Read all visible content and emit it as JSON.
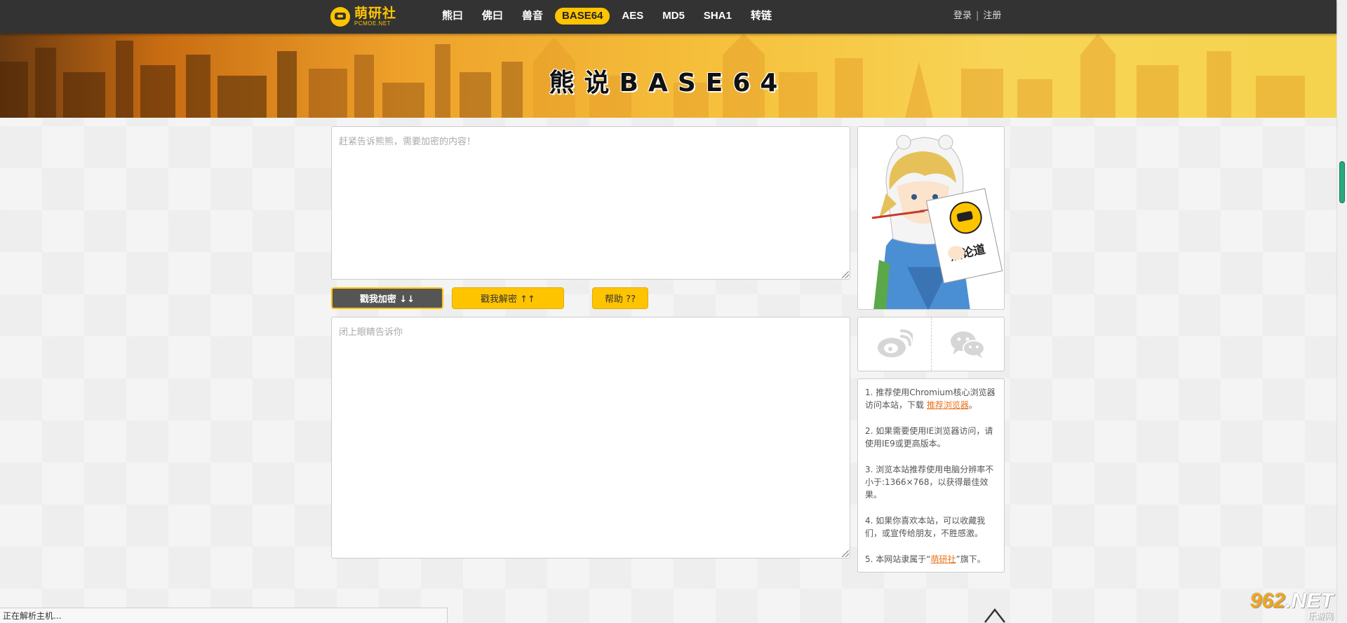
{
  "header": {
    "logo_cn": "萌研社",
    "logo_en": "PCMOE.NET",
    "nav": [
      {
        "label": "熊曰"
      },
      {
        "label": "佛曰"
      },
      {
        "label": "兽音"
      },
      {
        "label": "BASE64",
        "active": true
      },
      {
        "label": "AES"
      },
      {
        "label": "MD5"
      },
      {
        "label": "SHA1"
      },
      {
        "label": "转链"
      }
    ],
    "login": "登录",
    "separator": "|",
    "register": "注册"
  },
  "banner": {
    "title": "熊说BASE64"
  },
  "main": {
    "input_placeholder": "赶紧告诉熊熊，需要加密的内容！",
    "output_placeholder": "闭上眼睛告诉你",
    "encrypt_label": "戳我加密 ↓↓",
    "decrypt_label": "戳我解密 ↑↑",
    "help_label": "帮助 ??"
  },
  "sidebar": {
    "mascot_sign": "熊论道",
    "social": [
      {
        "icon": "weibo-icon"
      },
      {
        "icon": "wechat-icon"
      }
    ],
    "notes": [
      {
        "text": "1. 推荐使用Chromium核心浏览器访问本站，下载 ",
        "link": "推荐浏览器",
        "suffix": "。"
      },
      {
        "text": "2. 如果需要使用IE浏览器访问，请使用IE9或更高版本。",
        "link": "",
        "suffix": ""
      },
      {
        "text": "3. 浏览本站推荐使用电脑分辨率不小于:1366×768，以获得最佳效果。",
        "link": "",
        "suffix": ""
      },
      {
        "text": "4. 如果你喜欢本站，可以收藏我们，或宣传给朋友，不胜感激。",
        "link": "",
        "suffix": ""
      },
      {
        "text": "5. 本网站隶属于“",
        "link": "萌研社",
        "suffix": "”旗下。"
      }
    ]
  },
  "status": {
    "text": "正在解析主机..."
  },
  "watermark": {
    "main_prefix": "962",
    "main_suffix": ".NET",
    "sub": "乐游网"
  },
  "colors": {
    "accent": "#ffc400",
    "nav_bg": "#333333",
    "link": "#e8731b"
  }
}
